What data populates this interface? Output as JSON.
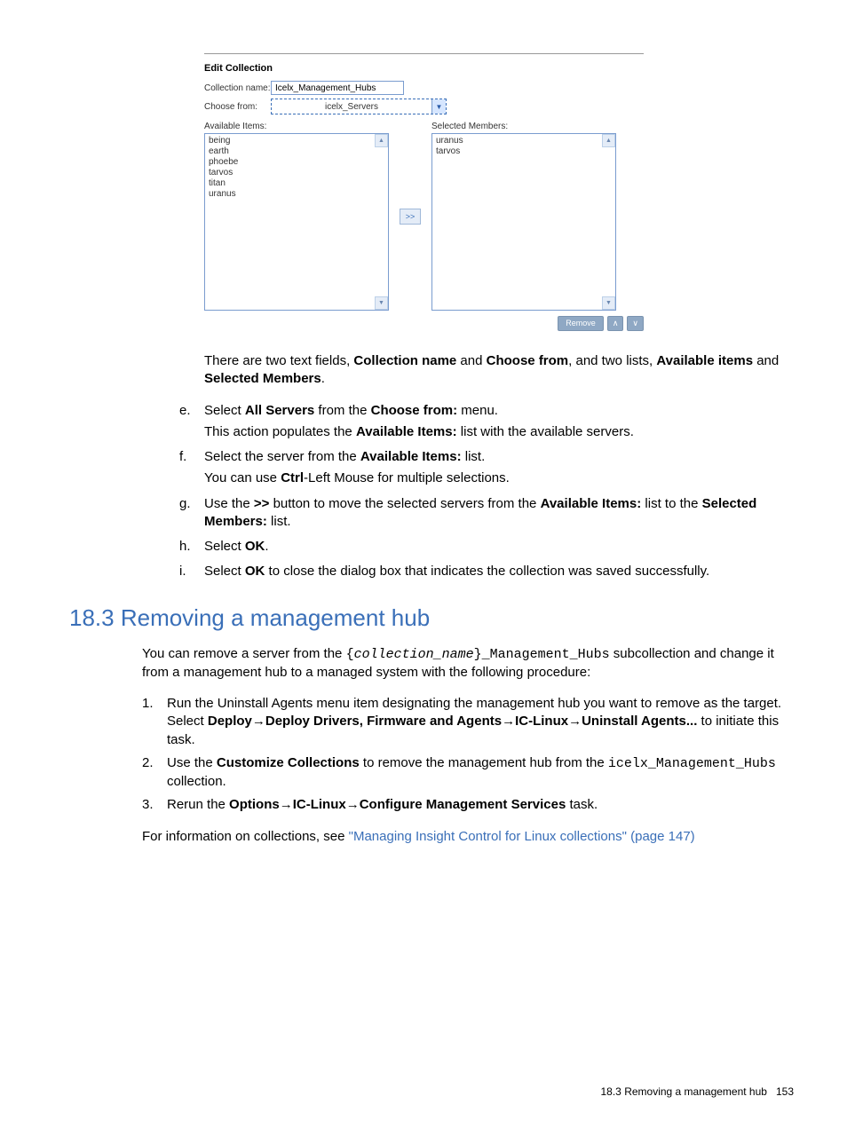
{
  "dialog": {
    "title": "Edit Collection",
    "labels": {
      "collection_name": "Collection name:",
      "choose_from": "Choose from:",
      "available_items": "Available Items:",
      "selected_members": "Selected Members:"
    },
    "values": {
      "collection_name": "Icelx_Management_Hubs",
      "choose_from": "icelx_Servers"
    },
    "available_list": [
      "being",
      "earth",
      "phoebe",
      "tarvos",
      "titan",
      "uranus"
    ],
    "selected_list": [
      "uranus",
      "tarvos"
    ],
    "transfer_btn": ">>",
    "remove_btn": "Remove",
    "up_btn": "∧",
    "down_btn": "∨"
  },
  "intro_para": {
    "p1a": "There are two text fields, ",
    "b1": "Collection name",
    "p1b": " and ",
    "b2": "Choose from",
    "p1c": ", and two lists, ",
    "b3": "Available items",
    "p1d": " and ",
    "b4": "Selected Members",
    "p1e": "."
  },
  "steps_e": {
    "marker": "e.",
    "t1": "Select ",
    "b1": "All Servers",
    "t2": " from the ",
    "b2": "Choose from:",
    "t3": " menu.",
    "sub_a": "This action populates the ",
    "sub_b": "Available Items:",
    "sub_c": " list with the available servers."
  },
  "steps_f": {
    "marker": "f.",
    "t1": "Select the server from the ",
    "b1": "Available Items:",
    "t2": " list.",
    "sub_a": "You can use ",
    "sub_b": "Ctrl",
    "sub_c": "-Left Mouse for multiple selections."
  },
  "steps_g": {
    "marker": "g.",
    "t1": "Use the ",
    "b1": ">>",
    "t2": " button to move the selected servers from the ",
    "b2": "Available Items:",
    "t3": " list to the ",
    "b3": "Selected Members:",
    "t4": " list."
  },
  "steps_h": {
    "marker": "h.",
    "t1": "Select ",
    "b1": "OK",
    "t2": "."
  },
  "steps_i": {
    "marker": "i.",
    "t1": "Select ",
    "b1": "OK",
    "t2": " to close the dialog box that indicates the collection was saved successfully."
  },
  "section": {
    "heading": "18.3 Removing a management hub",
    "intro_a": "You can remove a server from the ",
    "intro_code_open": "{",
    "intro_code_var": "collection_name",
    "intro_code_close": "}_Management_Hubs",
    "intro_b": " subcollection and change it from a management hub to a managed system with the following procedure:"
  },
  "num1": {
    "marker": "1.",
    "t1": "Run the Uninstall Agents menu item designating the management hub you want to remove as the target. Select ",
    "b1": "Deploy",
    "arrow1": "→",
    "b2": "Deploy Drivers, Firmware and Agents",
    "arrow2": "→",
    "b3": "IC-Linux",
    "arrow3": "→",
    "b4": "Uninstall Agents...",
    "t2": " to initiate this task."
  },
  "num2": {
    "marker": "2.",
    "t1": "Use the ",
    "b1": "Customize Collections",
    "t2": " to remove the management hub from the ",
    "code": "icelx_Management_Hubs",
    "t3": " collection."
  },
  "num3": {
    "marker": "3.",
    "t1": "Rerun the ",
    "b1": "Options",
    "arrow1": "→",
    "b2": "IC-Linux",
    "arrow2": "→",
    "b3": "Configure Management Services",
    "t2": " task."
  },
  "closing": {
    "t1": "For information on collections, see ",
    "link": "\"Managing Insight Control for Linux collections\" (page 147)"
  },
  "footer": {
    "text": "18.3 Removing a management hub",
    "page": "153"
  }
}
